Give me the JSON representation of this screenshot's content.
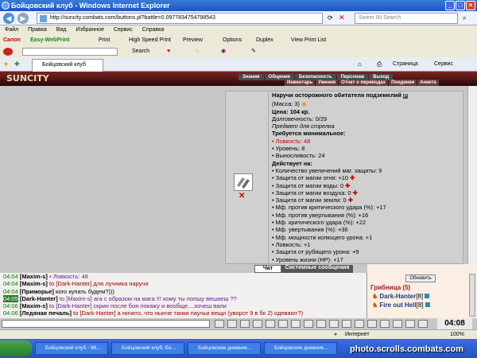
{
  "window": {
    "title": "Бойцовский клуб - Windows Internet Explorer"
  },
  "address": {
    "url": "http://suncity.combats.com/buttons.pl?battle=0.0977834754798543",
    "search_placeholder": "Sweet IM Search"
  },
  "menu": [
    "Файл",
    "Правка",
    "Вид",
    "Избранное",
    "Сервис",
    "Справка"
  ],
  "canon_toolbar": {
    "brand": "Canon",
    "product": "Easy-WebPrint",
    "print": "Print",
    "hs_print": "High Speed Print",
    "preview": "Preview",
    "options": "Options",
    "duplex": "Duplex",
    "view_list": "View Print List"
  },
  "toolbar3": {
    "search": "Search"
  },
  "tab": {
    "label": "Бойцовский клуб",
    "page_btn": "Страница",
    "service_btn": "Сервис"
  },
  "game_nav": {
    "row1": [
      "Знания",
      "Общение",
      "Безопасность",
      "Персонаж",
      "Выход"
    ],
    "row2": [
      "Инвентарь",
      "Умения",
      "Отчет о переводах",
      "Поединки",
      "Анкета"
    ]
  },
  "logo": "SUNCITY",
  "item": {
    "title": "Наручи осторожного обитателя подземелий",
    "mass": "(Масса: 3)",
    "price_label": "Цена: 104 кр.",
    "durability": "Долговечность: 0/29",
    "purpose": "Предмет для стрелка",
    "req_header": "Требуется минимальное:",
    "requirements": [
      "Ловкость: 48",
      "Уровень: 8",
      "Выносливость: 24"
    ],
    "acts_header": "Действует на:",
    "effects": [
      "Количество увеличений маг. защиты: 9",
      "Защита от магии огня: +10",
      "Защита от магии воды: 0",
      "Защита от магии воздуха: 0",
      "Защита от магии земли: 0",
      "Мф. против критического удара (%): +17",
      "Мф. против увертывания (%): +16",
      "Мф. критического удара (%): +22",
      "Мф. увертывания (%): +36",
      "Мф. мощности колющего урона: +1",
      "Ловкость: +1",
      "Защита от рубящего урона: +9",
      "Уровень жизни (HP): +17"
    ],
    "plus_marks": [
      false,
      true,
      true,
      true,
      true,
      false,
      false,
      false,
      false,
      false,
      false,
      false,
      false
    ]
  },
  "chat_tabs": [
    "Чат",
    "Системные сообщения"
  ],
  "chat": [
    {
      "time": "04:04",
      "name": "[Maxim-s]",
      "text": "• Ловкость: 48",
      "style": "pu",
      "hl": false
    },
    {
      "time": "04:04",
      "name": "[Maxim-s]",
      "text": "to [Dark-Hanter] для лучника наручи",
      "style": "pv",
      "hl": false
    },
    {
      "time": "04:04",
      "name": "[Приморье]",
      "text": "кого купать будем?)))",
      "style": "",
      "hl": false
    },
    {
      "time": "04:05",
      "name": "[Dark-Hanter]",
      "text": "to [Maxim-s] ага с образом на мага !!! кому ты лопшу вешаеш ??",
      "style": "pu",
      "hl": true
    },
    {
      "time": "04:06",
      "name": "[Maxim-s]",
      "text": "to [Dark-Hanter] скрин после боя покажу и вообще....хочеш вали",
      "style": "pu",
      "hl": false
    },
    {
      "time": "04:06",
      "name": "[Ледяная печаль]",
      "text": "to [Dark-Hanter] а ничего, что нынче танки паучьи вещи (уворот 9 в бк 2) одевают?)",
      "style": "pv",
      "hl": false
    }
  ],
  "side": {
    "refresh_label": "Обновить",
    "group": "Грибница (5)",
    "members": [
      {
        "name": "Dark-Hanter",
        "level": "[8]"
      },
      {
        "name": "Fire out Hell",
        "level": "[8]"
      }
    ]
  },
  "clock": "04:08",
  "status": {
    "zone": "Интернет",
    "zoom": "100%"
  },
  "taskbar": {
    "tasks": [
      "Бойцовский клуб - Wi...",
      "Бойцовский клуб: Бо...",
      "Бойцовские дневник...",
      "Бойцовские дневник..."
    ],
    "watermark": "photo.scrolls.combats.com"
  }
}
